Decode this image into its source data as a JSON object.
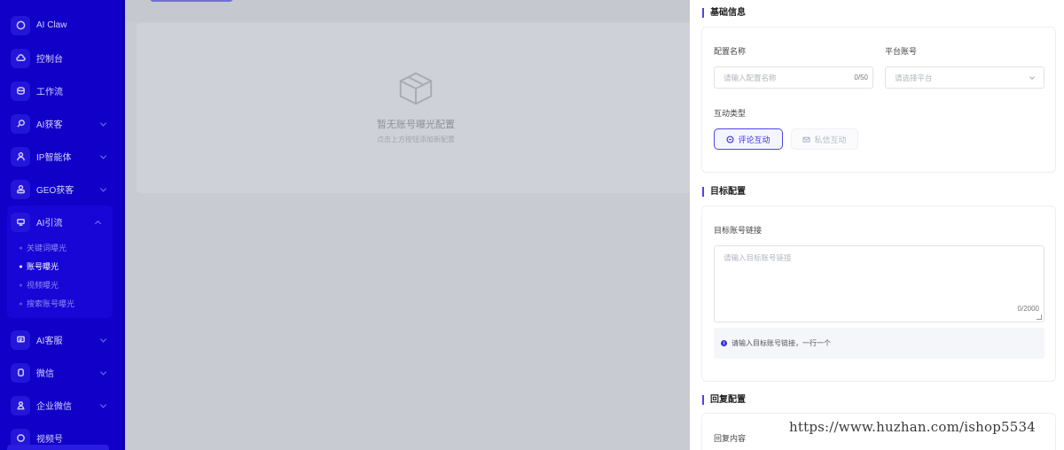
{
  "sidebar": {
    "items": [
      {
        "label": "AI Claw",
        "icon": "chat-bubble-icon"
      },
      {
        "label": "控制台",
        "icon": "cloud-icon"
      },
      {
        "label": "工作流",
        "icon": "workflow-icon"
      },
      {
        "label": "AI获客",
        "icon": "search-icon"
      },
      {
        "label": "IP智能体",
        "icon": "user-icon"
      },
      {
        "label": "GEO获客",
        "icon": "user-badge-icon"
      },
      {
        "label": "AI引流",
        "icon": "store-icon"
      },
      {
        "label": "AI客服",
        "icon": "message-icon"
      },
      {
        "label": "微信",
        "icon": "wechat-icon"
      },
      {
        "label": "企业微信",
        "icon": "person-icon"
      },
      {
        "label": "视频号",
        "icon": "video-icon"
      }
    ],
    "ai_traffic_children": [
      {
        "label": "关键词曝光"
      },
      {
        "label": "账号曝光"
      },
      {
        "label": "视频曝光"
      },
      {
        "label": "搜索账号曝光"
      }
    ]
  },
  "main": {
    "empty_title": "暂无账号曝光配置",
    "empty_subtitle": "点击上方按钮添加新配置"
  },
  "drawer": {
    "basic_section_title": "基础信息",
    "config_name_label": "配置名称",
    "config_name_placeholder": "请输入配置名称",
    "config_name_counter": "0/50",
    "platform_label": "平台账号",
    "platform_placeholder": "请选择平台",
    "interaction_type_label": "互动类型",
    "interaction_types": [
      {
        "label": "评论互动",
        "selected": true
      },
      {
        "label": "私信互动",
        "selected": false
      }
    ],
    "target_section_title": "目标配置",
    "target_link_label": "目标账号链接",
    "target_link_placeholder": "请输入目标账号链接",
    "target_link_counter": "0/2000",
    "target_link_hint": "请输入目标账号链接，一行一个",
    "reply_section_title": "回复配置",
    "reply_content_label": "回复内容"
  },
  "watermark": "https://www.huzhan.com/ishop5534",
  "colors": {
    "sidebar_bg": "#1000c8",
    "accent": "#4b46e6",
    "overlay": "#c9cbd3"
  }
}
